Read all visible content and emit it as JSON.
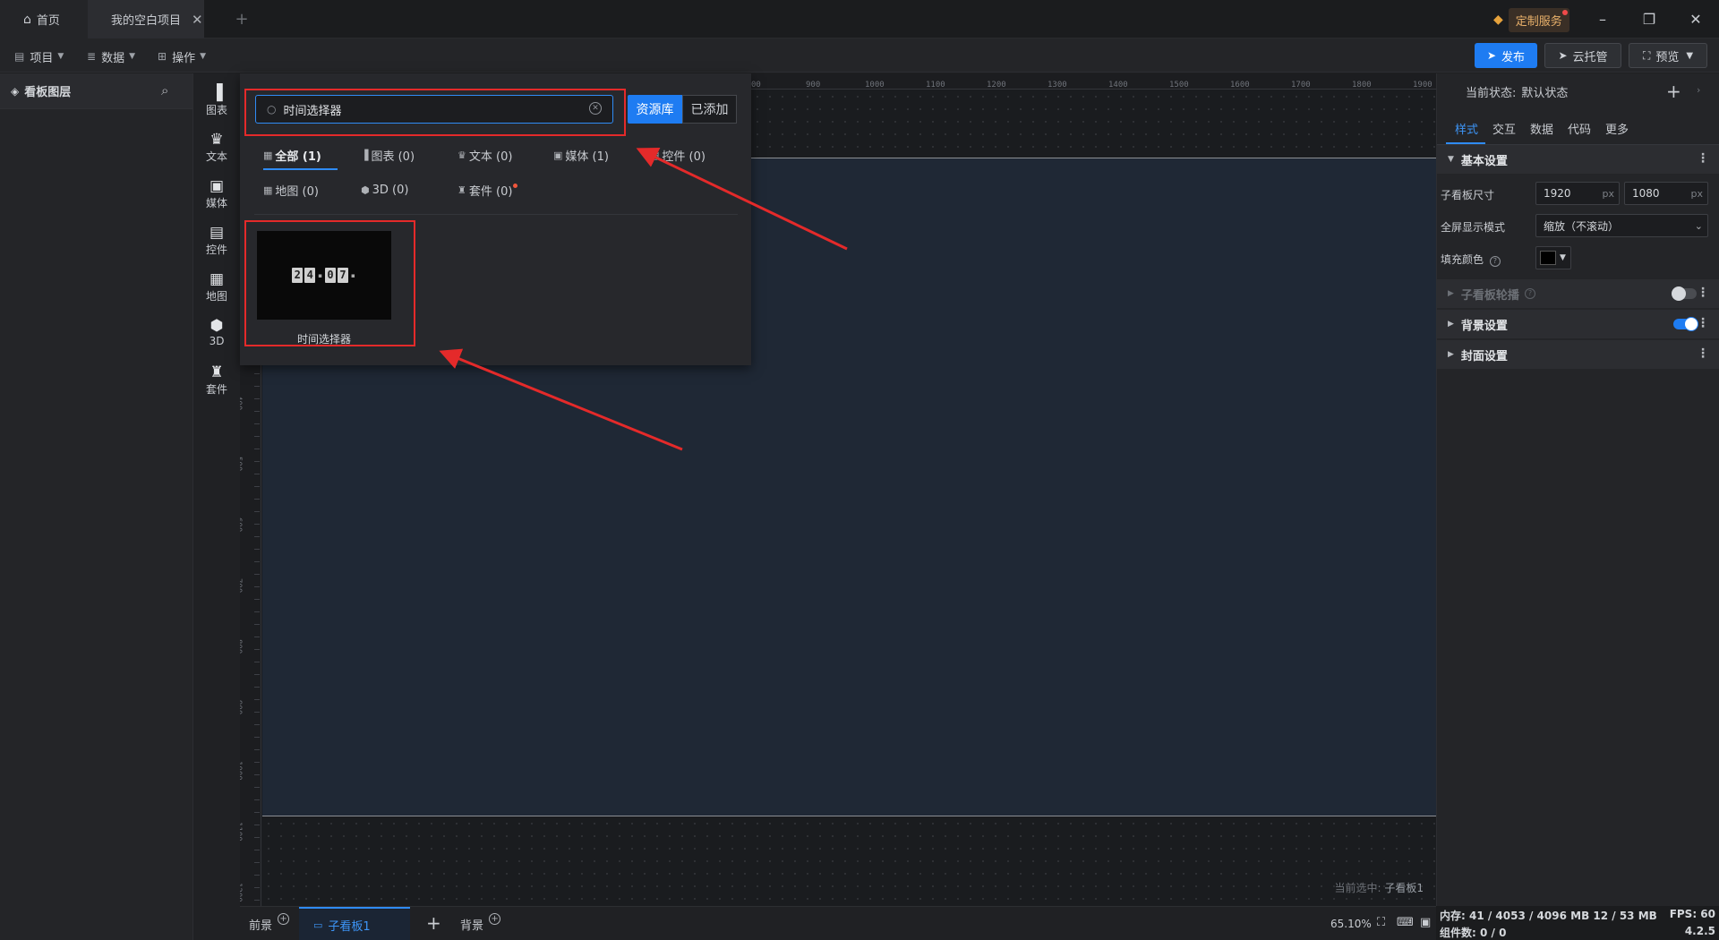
{
  "tabs": {
    "home": "首页",
    "project": "我的空白项目"
  },
  "titlebar": {
    "custom_service": "定制服务"
  },
  "menu": {
    "project": "项目",
    "data": "数据",
    "operation": "操作"
  },
  "actions": {
    "publish": "发布",
    "cloud": "云托管",
    "preview": "预览"
  },
  "layer_panel": {
    "title": "看板图层"
  },
  "tools": [
    {
      "label": "图表",
      "icon": "bar-chart-icon"
    },
    {
      "label": "文本",
      "icon": "text-icon"
    },
    {
      "label": "媒体",
      "icon": "media-icon"
    },
    {
      "label": "控件",
      "icon": "widget-icon"
    },
    {
      "label": "地图",
      "icon": "map-icon"
    },
    {
      "label": "3D",
      "icon": "cube-icon"
    },
    {
      "label": "套件",
      "icon": "shirt-icon"
    }
  ],
  "ruler": {
    "top": [
      "00",
      "900",
      "1000",
      "1100",
      "1200",
      "1300",
      "1400",
      "1500",
      "1600",
      "1700",
      "1800",
      "1900"
    ],
    "left": [
      "400",
      "500",
      "600",
      "700",
      "800",
      "900",
      "1000",
      "1100",
      "1200"
    ]
  },
  "resource": {
    "search_value": "时间选择器",
    "tab_library": "资源库",
    "tab_added": "已添加",
    "categories": [
      {
        "label": "全部 (1)",
        "active": true
      },
      {
        "label": "图表 (0)"
      },
      {
        "label": "文本 (0)"
      },
      {
        "label": "媒体 (1)"
      },
      {
        "label": "控件 (0)"
      },
      {
        "label": "地图 (0)"
      },
      {
        "label": "3D (0)"
      },
      {
        "label": "套件 (0)",
        "new": true
      }
    ],
    "result": {
      "label": "时间选择器",
      "thumb_digits": [
        "2",
        "4",
        "0",
        "7"
      ]
    }
  },
  "canvas": {
    "current_selection_label": "当前选中:",
    "current_selection_value": "子看板1"
  },
  "right_panel": {
    "state_label": "当前状态:",
    "state_value": "默认状态",
    "tabs": [
      "样式",
      "交互",
      "数据",
      "代码",
      "更多"
    ],
    "basic_title": "基本设置",
    "size_label": "子看板尺寸",
    "width": "1920",
    "height": "1080",
    "unit": "px",
    "fullscreen_label": "全屏显示模式",
    "fullscreen_value": "缩放（不滚动）",
    "fill_label": "填充颜色",
    "fill_color": "#000000",
    "carousel_title": "子看板轮播",
    "carousel_on": false,
    "background_title": "背景设置",
    "background_on": true,
    "cover_title": "封面设置"
  },
  "bottom": {
    "front": "前景",
    "sub": "子看板1",
    "background": "背景",
    "zoom": "65.10%"
  },
  "status": {
    "memory": "内存: 41 / 4053 / 4096 MB  12 / 53 MB",
    "fps": "FPS: 60",
    "count": "组件数: 0 / 0",
    "version": "4.2.5"
  },
  "colors": {
    "accent": "#1e7cf2",
    "annotation": "#e42a2a"
  }
}
